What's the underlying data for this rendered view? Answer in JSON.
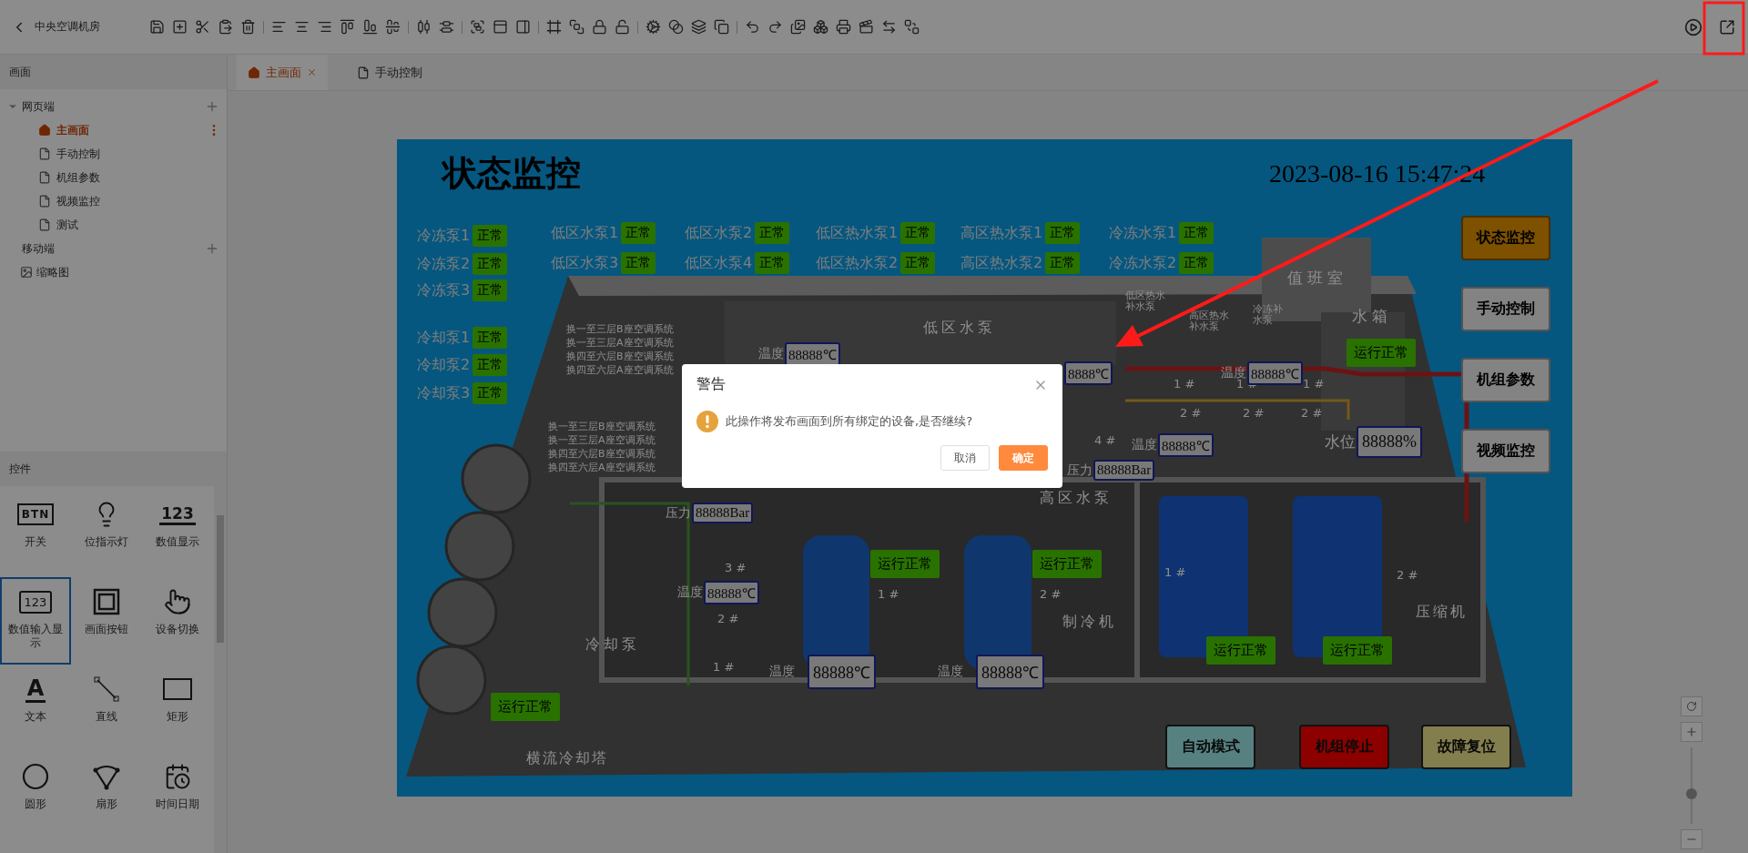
{
  "app": {
    "title": "中央空调机房"
  },
  "left_panel": {
    "pages_title": "画面",
    "sections": [
      {
        "label": "网页端",
        "expanded": true,
        "pages": [
          {
            "label": "主画面",
            "kind": "home",
            "selected": true
          },
          {
            "label": "手动控制",
            "kind": "page",
            "selected": false
          },
          {
            "label": "机组参数",
            "kind": "page",
            "selected": false
          },
          {
            "label": "视频监控",
            "kind": "page",
            "selected": false
          },
          {
            "label": "测试",
            "kind": "page",
            "selected": false
          }
        ]
      },
      {
        "label": "移动端",
        "expanded": false
      }
    ],
    "thumbnail": {
      "label": "缩略图"
    },
    "widgets_title": "控件",
    "widgets": [
      {
        "label": "开关",
        "kind": "btn",
        "icon_text": "BTN",
        "selected": false
      },
      {
        "label": "位指示灯",
        "kind": "bulb",
        "selected": false
      },
      {
        "label": "数值显示",
        "kind": "number",
        "icon_text": "123",
        "selected": false
      },
      {
        "label": "数值输入显示",
        "kind": "number-input",
        "icon_text": "123",
        "selected": true
      },
      {
        "label": "画面按钮",
        "kind": "frame",
        "selected": false
      },
      {
        "label": "设备切换",
        "kind": "switch",
        "selected": false
      },
      {
        "label": "文本",
        "kind": "text",
        "icon_text": "A",
        "selected": false
      },
      {
        "label": "直线",
        "kind": "line",
        "selected": false
      },
      {
        "label": "矩形",
        "kind": "rect",
        "selected": false
      },
      {
        "label": "圆形",
        "kind": "circle",
        "selected": false
      },
      {
        "label": "扇形",
        "kind": "sector",
        "selected": false
      },
      {
        "label": "时间日期",
        "kind": "datetime",
        "selected": false
      }
    ]
  },
  "tabs": [
    {
      "label": "主画面",
      "kind": "home",
      "selected": true,
      "closable": true
    },
    {
      "label": "手动控制",
      "kind": "page",
      "selected": false,
      "closable": false
    }
  ],
  "canvas": {
    "title": "状态监控",
    "datetime": "2023-08-16 15:47:24",
    "side_pumps": [
      {
        "name": "冷冻泵1",
        "status": "正常"
      },
      {
        "name": "冷冻泵2",
        "status": "正常"
      },
      {
        "name": "冷冻泵3",
        "status": "正常"
      },
      {
        "name": "冷却泵1",
        "status": "正常"
      },
      {
        "name": "冷却泵2",
        "status": "正常"
      },
      {
        "name": "冷却泵3",
        "status": "正常"
      }
    ],
    "zone_pumps": [
      {
        "name": "低区水泵1",
        "status": "正常"
      },
      {
        "name": "低区水泵2",
        "status": "正常"
      },
      {
        "name": "低区热水泵1",
        "status": "正常"
      },
      {
        "name": "高区热水泵1",
        "status": "正常"
      },
      {
        "name": "冷冻水泵1",
        "status": "正常"
      },
      {
        "name": "低区水泵3",
        "status": "正常"
      },
      {
        "name": "低区水泵4",
        "status": "正常"
      },
      {
        "name": "低区热水泵2",
        "status": "正常"
      },
      {
        "name": "高区热水泵2",
        "status": "正常"
      },
      {
        "name": "冷冻水泵2",
        "status": "正常"
      }
    ],
    "nav_buttons": [
      {
        "label": "状态监控",
        "selected": true
      },
      {
        "label": "手动控制",
        "selected": false
      },
      {
        "label": "机组参数",
        "selected": false
      },
      {
        "label": "视频监控",
        "selected": false
      }
    ],
    "scene_labels": [
      "值班室",
      "水箱",
      "低区水泵",
      "低区热水补水泵",
      "高区热水补水泵",
      "冷冻补水泵",
      "换一至三层B座空调系统",
      "换一至三层A座空调系统",
      "换四至六层B座空调系统",
      "换四至六层A座空调系统",
      "换一至三层B座空调系统",
      "换一至三层A座空调系统",
      "换四至六层B座空调系统",
      "换四至六层A座空调系统",
      "高区水泵",
      "冷却泵",
      "制冷机",
      "压缩机",
      "横流冷却塔",
      "3 #",
      "2 #",
      "1 #",
      "1 #",
      "2 #",
      "1 #",
      "2 #",
      "4 #",
      "1 #",
      "1 #",
      "1 #",
      "2 #",
      "2 #",
      "2 #"
    ],
    "readings": [
      {
        "label": "温度",
        "value": "88888℃"
      },
      {
        "value": "8888℃"
      },
      {
        "label": "温度",
        "value": "88888℃"
      },
      {
        "label": "温度",
        "value": "88888℃"
      },
      {
        "label": "压力",
        "value": "88888Bar"
      },
      {
        "label": "水位",
        "value": "88888%"
      },
      {
        "label": "压力",
        "value": "88888Bar"
      },
      {
        "label": "温度",
        "value": "88888℃"
      },
      {
        "label": "温度",
        "value": "88888℃"
      },
      {
        "label": "温度",
        "value": "88888℃"
      }
    ],
    "run_badges": [
      "运行正常",
      "运行正常",
      "运行正常",
      "运行正常",
      "运行正常",
      "运行正常"
    ],
    "mode_buttons": [
      {
        "label": "自动模式",
        "kind": "auto"
      },
      {
        "label": "机组停止",
        "kind": "stop"
      },
      {
        "label": "故障复位",
        "kind": "reset"
      }
    ]
  },
  "zoom_slider": {
    "level": 0.38
  },
  "dialog": {
    "title": "警告",
    "message": "此操作将发布画面到所有绑定的设备,是否继续?",
    "buttons": [
      {
        "label": "取消",
        "kind": "secondary"
      },
      {
        "label": "确定",
        "kind": "primary"
      }
    ]
  }
}
